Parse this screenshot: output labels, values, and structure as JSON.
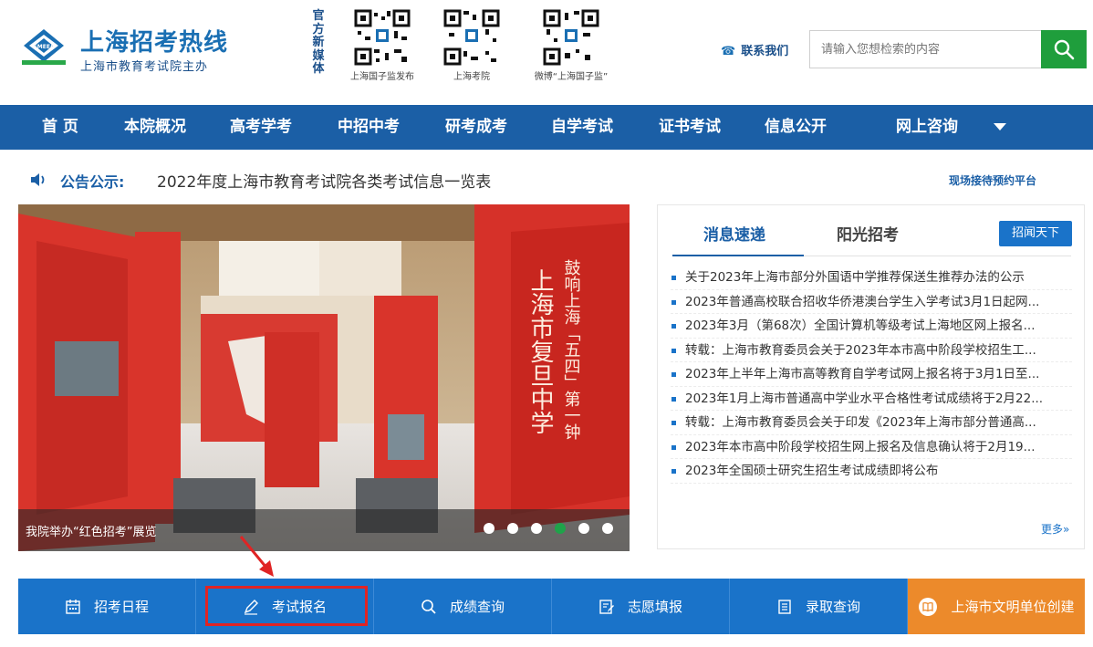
{
  "header": {
    "logo_badge": "SMEEA",
    "site_title": "上海招考热线",
    "site_subtitle": "上海市教育考试院主办",
    "media_label": "官方新媒体",
    "qr_codes": [
      {
        "caption": "上海国子监发布"
      },
      {
        "caption": "上海考院"
      },
      {
        "caption": "微博“上海国子监”"
      }
    ],
    "contact_label": "联系我们",
    "search_placeholder": "请输入您想检索的内容"
  },
  "nav": {
    "items": [
      "首 页",
      "本院概况",
      "高考学考",
      "中招中考",
      "研考成考",
      "自学考试",
      "证书考试",
      "信息公开",
      "网上咨询"
    ]
  },
  "notice": {
    "label": "公告公示:",
    "text": "2022年度上海市教育考试院各类考试信息一览表",
    "appointment_link": "现场接待预约平台"
  },
  "carousel": {
    "caption": "我院举办“红色招考”展览",
    "slide_count": 6,
    "active_slide": 4,
    "poster_text": "上海市复旦中学",
    "poster_text_2": "鼓响上海「五四」第一钟"
  },
  "news": {
    "tab_active": "消息速递",
    "tab_inactive": "阳光招考",
    "tag_button": "招闻天下",
    "items": [
      "关于2023年上海市部分外国语中学推荐保送生推荐办法的公示",
      "2023年普通高校联合招收华侨港澳台学生入学考试3月1日起网...",
      "2023年3月（第68次）全国计算机等级考试上海地区网上报名...",
      "转载：上海市教育委员会关于2023年本市高中阶段学校招生工...",
      "2023年上半年上海市高等教育自学考试网上报名将于3月1日至...",
      "2023年1月上海市普通高中学业水平合格性考试成绩将于2月22...",
      "转载：上海市教育委员会关于印发《2023年上海市部分普通高...",
      "2023年本市高中阶段学校招生网上报名及信息确认将于2月19...",
      "2023年全国硕士研究生招生考试成绩即将公布"
    ],
    "more_label": "更多»"
  },
  "quickbar": {
    "items": [
      {
        "label": "招考日程",
        "icon": "calendar-icon"
      },
      {
        "label": "考试报名",
        "icon": "pen-icon"
      },
      {
        "label": "成绩查询",
        "icon": "search-icon"
      },
      {
        "label": "志愿填报",
        "icon": "edit-form-icon"
      },
      {
        "label": "录取查询",
        "icon": "document-list-icon"
      },
      {
        "label": "上海市文明单位创建",
        "icon": "book-icon"
      }
    ]
  },
  "colors": {
    "brand_blue": "#1b5fa6",
    "accent_blue": "#1a73c9",
    "search_green": "#1f9e3c",
    "orange": "#ec8a2b",
    "highlight_red": "#e02424"
  }
}
